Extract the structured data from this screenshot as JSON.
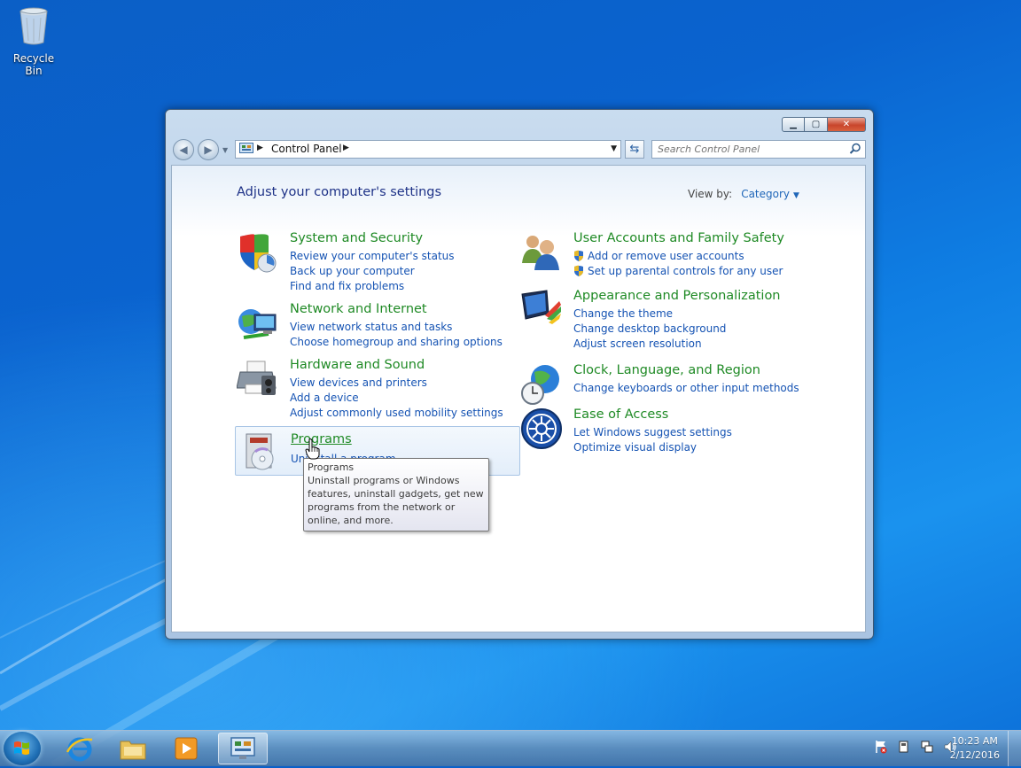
{
  "desktop": {
    "recycle_bin_label": "Recycle Bin"
  },
  "window": {
    "address": {
      "crumb": "Control Panel"
    },
    "search": {
      "placeholder": "Search Control Panel"
    },
    "page_title": "Adjust your computer's settings",
    "view_by": {
      "label": "View by:",
      "value": "Category"
    },
    "categories": [
      {
        "title": "System and Security",
        "icon": "shield-icon",
        "links": [
          "Review your computer's status",
          "Back up your computer",
          "Find and fix problems"
        ]
      },
      {
        "title": "Network and Internet",
        "icon": "network-icon",
        "links": [
          "View network status and tasks",
          "Choose homegroup and sharing options"
        ]
      },
      {
        "title": "Hardware and Sound",
        "icon": "printer-icon",
        "links": [
          "View devices and printers",
          "Add a device",
          "Adjust commonly used mobility settings"
        ]
      },
      {
        "title": "Programs",
        "icon": "programs-icon",
        "links": [
          "Uninstall a program"
        ]
      },
      {
        "title": "User Accounts and Family Safety",
        "icon": "users-icon",
        "links": [
          "Add or remove user accounts",
          "Set up parental controls for any user"
        ]
      },
      {
        "title": "Appearance and Personalization",
        "icon": "monitor-paint-icon",
        "links": [
          "Change the theme",
          "Change desktop background",
          "Adjust screen resolution"
        ]
      },
      {
        "title": "Clock, Language, and Region",
        "icon": "globe-clock-icon",
        "links": [
          "Change keyboards or other input methods"
        ]
      },
      {
        "title": "Ease of Access",
        "icon": "ease-of-access-icon",
        "links": [
          "Let Windows suggest settings",
          "Optimize visual display"
        ]
      }
    ],
    "tooltip": {
      "title": "Programs",
      "body": "Uninstall programs or Windows features, uninstall gadgets, get new programs from the network or online, and more."
    }
  },
  "taskbar": {
    "clock": {
      "time": "10:23 AM",
      "date": "2/12/2016"
    }
  }
}
